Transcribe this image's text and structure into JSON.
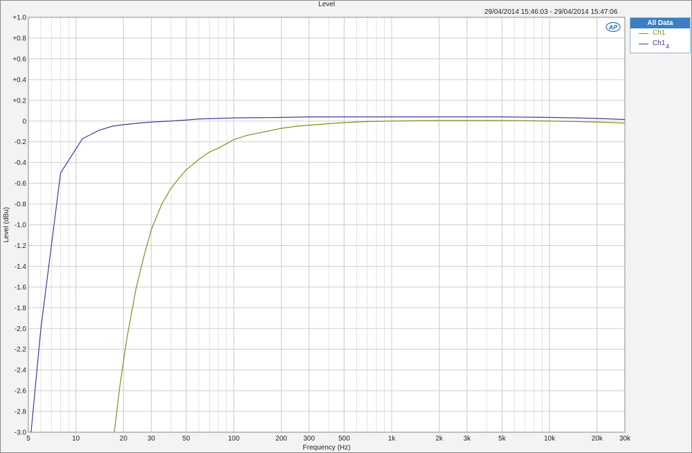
{
  "chart_data": {
    "type": "line",
    "title": "Level",
    "timestamp": "29/04/2014 15:46:03 -  29/04/2014 15:47:06",
    "xlabel": "Frequency (Hz)",
    "ylabel": "Level (dBu)",
    "x_scale": "log",
    "xlim": [
      5,
      30000
    ],
    "ylim": [
      -3.0,
      1.0
    ],
    "grid": true,
    "x_ticks": [
      {
        "value": 5,
        "label": "5"
      },
      {
        "value": 10,
        "label": "10"
      },
      {
        "value": 20,
        "label": "20"
      },
      {
        "value": 30,
        "label": "30"
      },
      {
        "value": 50,
        "label": "50"
      },
      {
        "value": 100,
        "label": "100"
      },
      {
        "value": 200,
        "label": "200"
      },
      {
        "value": 300,
        "label": "300"
      },
      {
        "value": 500,
        "label": "500"
      },
      {
        "value": 1000,
        "label": "1k"
      },
      {
        "value": 2000,
        "label": "2k"
      },
      {
        "value": 3000,
        "label": "3k"
      },
      {
        "value": 5000,
        "label": "5k"
      },
      {
        "value": 10000,
        "label": "10k"
      },
      {
        "value": 20000,
        "label": "20k"
      },
      {
        "value": 30000,
        "label": "30k"
      }
    ],
    "y_ticks": [
      {
        "value": 1.0,
        "label": "+1.0"
      },
      {
        "value": 0.8,
        "label": "+0.8"
      },
      {
        "value": 0.6,
        "label": "+0.6"
      },
      {
        "value": 0.4,
        "label": "+0.4"
      },
      {
        "value": 0.2,
        "label": "+0.2"
      },
      {
        "value": 0,
        "label": "0"
      },
      {
        "value": -0.2,
        "label": "-0.2"
      },
      {
        "value": -0.4,
        "label": "-0.4"
      },
      {
        "value": -0.6,
        "label": "-0.6"
      },
      {
        "value": -0.8,
        "label": "-0.8"
      },
      {
        "value": -1.0,
        "label": "-1.0"
      },
      {
        "value": -1.2,
        "label": "-1.2"
      },
      {
        "value": -1.4,
        "label": "-1.4"
      },
      {
        "value": -1.6,
        "label": "-1.6"
      },
      {
        "value": -1.8,
        "label": "-1.8"
      },
      {
        "value": -2.0,
        "label": "-2.0"
      },
      {
        "value": -2.2,
        "label": "-2.2"
      },
      {
        "value": -2.4,
        "label": "-2.4"
      },
      {
        "value": -2.6,
        "label": "-2.6"
      },
      {
        "value": -2.8,
        "label": "-2.8"
      },
      {
        "value": -3.0,
        "label": "-3.0"
      }
    ],
    "legend": {
      "title": "All Data",
      "placement": "top-right"
    },
    "series": [
      {
        "name": "Ch1",
        "color": "#8a8a1e",
        "points": [
          [
            17.5,
            -3.0
          ],
          [
            19,
            -2.55
          ],
          [
            21,
            -2.1
          ],
          [
            24,
            -1.62
          ],
          [
            27,
            -1.3
          ],
          [
            30,
            -1.05
          ],
          [
            35,
            -0.8
          ],
          [
            40,
            -0.65
          ],
          [
            45,
            -0.55
          ],
          [
            50,
            -0.47
          ],
          [
            60,
            -0.37
          ],
          [
            70,
            -0.3
          ],
          [
            80,
            -0.26
          ],
          [
            100,
            -0.18
          ],
          [
            120,
            -0.14
          ],
          [
            150,
            -0.11
          ],
          [
            200,
            -0.07
          ],
          [
            250,
            -0.05
          ],
          [
            300,
            -0.04
          ],
          [
            400,
            -0.025
          ],
          [
            500,
            -0.015
          ],
          [
            700,
            -0.005
          ],
          [
            1000,
            0.0
          ],
          [
            2000,
            0.005
          ],
          [
            5000,
            0.005
          ],
          [
            10000,
            0.0
          ],
          [
            15000,
            -0.005
          ],
          [
            20000,
            -0.01
          ],
          [
            25000,
            -0.015
          ],
          [
            30000,
            -0.02
          ]
        ]
      },
      {
        "name": "Ch1",
        "subscript": "4",
        "color": "#3c3c9a",
        "points": [
          [
            5.2,
            -3.0
          ],
          [
            6,
            -2.0
          ],
          [
            8,
            -0.5
          ],
          [
            11,
            -0.17
          ],
          [
            14,
            -0.09
          ],
          [
            17,
            -0.05
          ],
          [
            20,
            -0.035
          ],
          [
            25,
            -0.02
          ],
          [
            30,
            -0.01
          ],
          [
            40,
            0.0
          ],
          [
            50,
            0.01
          ],
          [
            60,
            0.02
          ],
          [
            80,
            0.025
          ],
          [
            100,
            0.03
          ],
          [
            200,
            0.035
          ],
          [
            300,
            0.04
          ],
          [
            500,
            0.04
          ],
          [
            1000,
            0.04
          ],
          [
            2000,
            0.04
          ],
          [
            5000,
            0.04
          ],
          [
            10000,
            0.035
          ],
          [
            15000,
            0.03
          ],
          [
            20000,
            0.025
          ],
          [
            30000,
            0.015
          ]
        ]
      }
    ]
  }
}
